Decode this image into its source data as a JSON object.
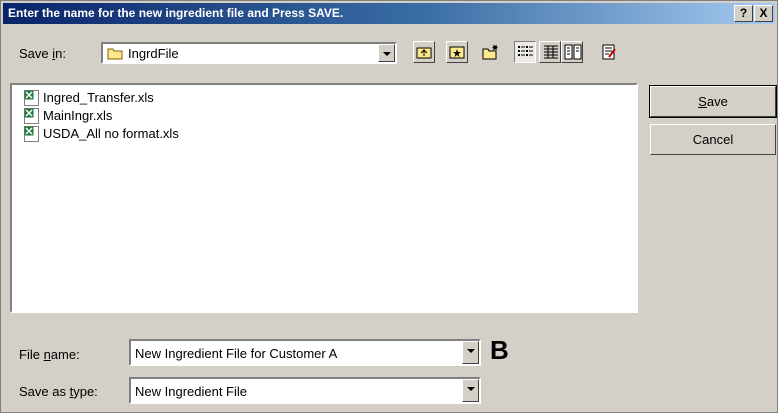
{
  "window": {
    "title": "Enter the name for the new ingredient file and Press SAVE.",
    "help_label": "?",
    "close_label": "X"
  },
  "save_in": {
    "label_pre": "Save ",
    "label_underline": "i",
    "label_post": "n:",
    "value": "IngrdFile"
  },
  "toolbar": {
    "icons": [
      "up-one-level-icon",
      "desktop-icon",
      "new-folder-icon",
      "list-view-icon",
      "details-view-icon",
      "properties-view-icon",
      "tools-icon"
    ]
  },
  "files": [
    {
      "name": "Ingred_Transfer.xls",
      "icon": "excel-file-icon"
    },
    {
      "name": "MainIngr.xls",
      "icon": "excel-file-icon"
    },
    {
      "name": "USDA_All no format.xls",
      "icon": "excel-file-icon"
    }
  ],
  "buttons": {
    "save_underline": "S",
    "save_rest": "ave",
    "cancel": "Cancel"
  },
  "file_name": {
    "label_pre": "File ",
    "label_underline": "n",
    "label_post": "ame:",
    "value": "New Ingredient File for Customer A"
  },
  "save_as_type": {
    "label_pre": "Save as ",
    "label_underline": "t",
    "label_post": "ype:",
    "value": "New Ingredient File"
  },
  "annotation": {
    "marker": "B"
  }
}
